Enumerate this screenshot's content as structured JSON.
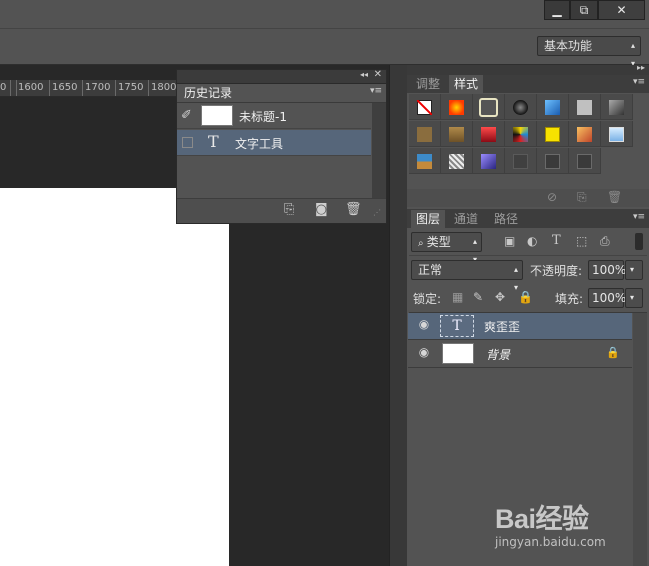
{
  "window": {
    "min_label": "▁",
    "restore_label": "⧉",
    "close_label": "✕"
  },
  "workspace": {
    "selected": "基本功能"
  },
  "ruler": {
    "ticks": [
      "0",
      "1600",
      "1650",
      "1700",
      "1750",
      "1800"
    ]
  },
  "history_panel": {
    "tab": "历史记录",
    "collapse_label": "◂◂",
    "close_label": "✕",
    "menu_label": "▾≡",
    "snapshot_name": "未标题-1",
    "items": [
      {
        "label": "文字工具",
        "icon": "T"
      }
    ]
  },
  "styles_panel": {
    "tabs": [
      "调整",
      "样式"
    ],
    "active_tab": "样式",
    "expand_label": "▸▸",
    "menu_label": "▾≡",
    "swatch_colors": [
      [
        "none",
        "#ff5a00",
        "#f4f0d6",
        "#333333",
        "#2f8fe0",
        "#c0c0c0",
        "#6d6d6d"
      ],
      [
        "#8a6d3e",
        "#97703c",
        "#c8192a",
        "#1c8bd4",
        "#f7e200",
        "#ef9a22",
        "#9cc8ef"
      ],
      [
        "#3d8bc9",
        "#cfcfcf",
        "#5855c0",
        "#404040",
        "#3a3a3a",
        "#3a3a3a"
      ]
    ]
  },
  "layers_panel": {
    "tabs": [
      "图层",
      "通道",
      "路径"
    ],
    "active_tab": "图层",
    "menu_label": "▾≡",
    "filter_label": "类型",
    "filter_icons": [
      "image-icon",
      "adjust-icon",
      "type-icon",
      "shape-icon",
      "smart-object-icon"
    ],
    "blend_mode": "正常",
    "opacity_label": "不透明度:",
    "opacity_value": "100%",
    "lock_label": "锁定:",
    "fill_label": "填充:",
    "fill_value": "100%",
    "layers": [
      {
        "name": "爽歪歪",
        "type": "text",
        "selected": true
      },
      {
        "name": "背景",
        "type": "raster",
        "selected": false,
        "locked": true
      }
    ]
  },
  "watermark": {
    "brand": "Bai经验",
    "url": "jingyan.baidu.com"
  },
  "colors": {
    "panel_bg": "#535353",
    "selection": "#56667a",
    "canvas": "#ffffff",
    "pasteboard": "#282828"
  }
}
